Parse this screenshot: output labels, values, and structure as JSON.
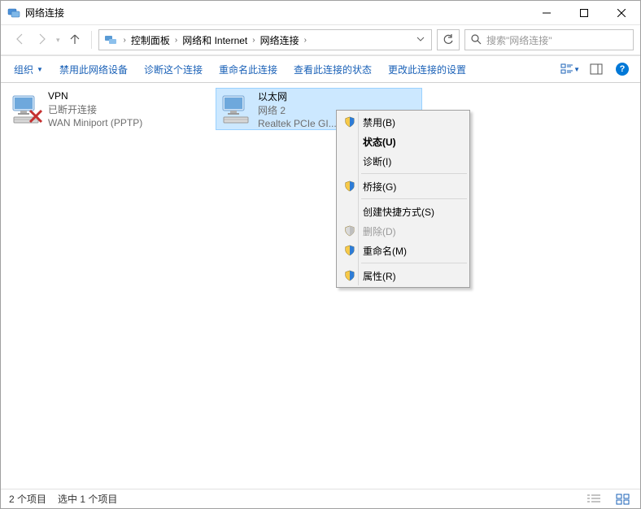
{
  "window": {
    "title": "网络连接"
  },
  "breadcrumbs": {
    "items": [
      "控制面板",
      "网络和 Internet",
      "网络连接"
    ]
  },
  "search": {
    "placeholder": "搜索\"网络连接\""
  },
  "commandbar": {
    "organize": "组织",
    "disable": "禁用此网络设备",
    "diagnose": "诊断这个连接",
    "rename": "重命名此连接",
    "status": "查看此连接的状态",
    "settings": "更改此连接的设置"
  },
  "connections": [
    {
      "name": "VPN",
      "line2": "已断开连接",
      "line3": "WAN Miniport (PPTP)",
      "selected": false,
      "disconnected": true
    },
    {
      "name": "以太网",
      "line2": "网络 2",
      "line3": "Realtek PCIe GI...",
      "selected": true,
      "disconnected": false
    }
  ],
  "contextmenu": {
    "items": [
      {
        "label": "禁用(B)",
        "shield": true,
        "disabled": false,
        "bold": false,
        "sep": false
      },
      {
        "label": "状态(U)",
        "shield": false,
        "disabled": false,
        "bold": true,
        "sep": false
      },
      {
        "label": "诊断(I)",
        "shield": false,
        "disabled": false,
        "bold": false,
        "sep": true
      },
      {
        "label": "桥接(G)",
        "shield": true,
        "disabled": false,
        "bold": false,
        "sep": true
      },
      {
        "label": "创建快捷方式(S)",
        "shield": false,
        "disabled": false,
        "bold": false,
        "sep": false
      },
      {
        "label": "删除(D)",
        "shield": true,
        "disabled": true,
        "bold": false,
        "sep": false
      },
      {
        "label": "重命名(M)",
        "shield": true,
        "disabled": false,
        "bold": false,
        "sep": true
      },
      {
        "label": "属性(R)",
        "shield": true,
        "disabled": false,
        "bold": false,
        "sep": false
      }
    ]
  },
  "statusbar": {
    "count": "2 个项目",
    "selection": "选中 1 个项目"
  }
}
